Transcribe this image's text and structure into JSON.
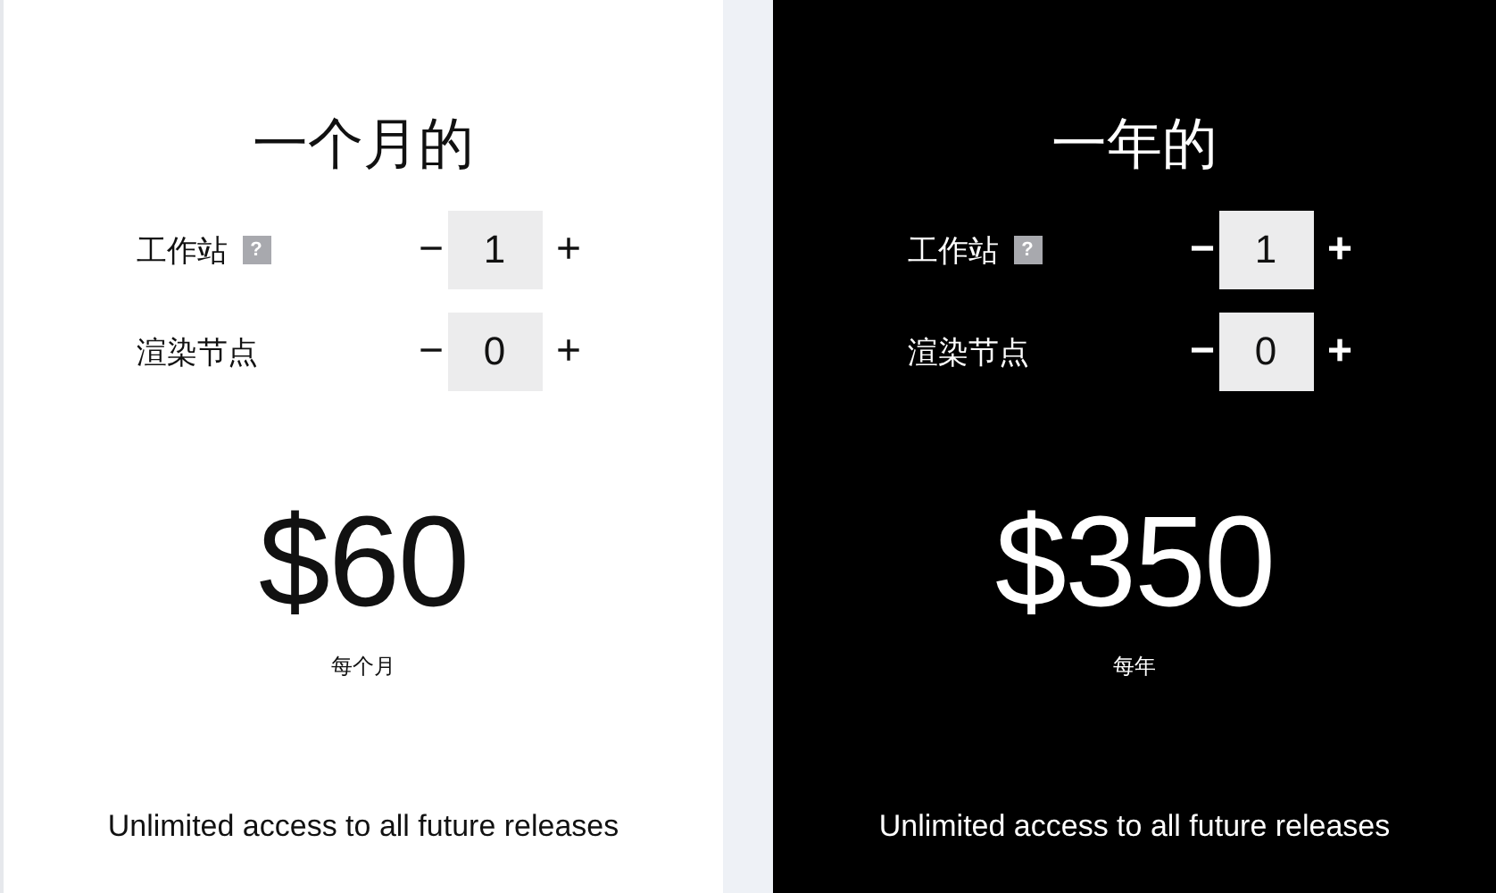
{
  "plans": [
    {
      "kind": "light",
      "title": "一个月的",
      "rows": [
        {
          "label": "工作站",
          "help": "?",
          "minus": "−",
          "value": "1",
          "plus": "+"
        },
        {
          "label": "渲染节点",
          "minus": "−",
          "value": "0",
          "plus": "+"
        }
      ],
      "price": "$60",
      "period": "每个月",
      "note": "Unlimited access to all future releases"
    },
    {
      "kind": "dark",
      "title": "一年的",
      "rows": [
        {
          "label": "工作站",
          "help": "?",
          "minus": "−",
          "value": "1",
          "plus": "+"
        },
        {
          "label": "渲染节点",
          "minus": "−",
          "value": "0",
          "plus": "+"
        }
      ],
      "price": "$350",
      "period": "每年",
      "note": "Unlimited access to all future releases"
    }
  ]
}
